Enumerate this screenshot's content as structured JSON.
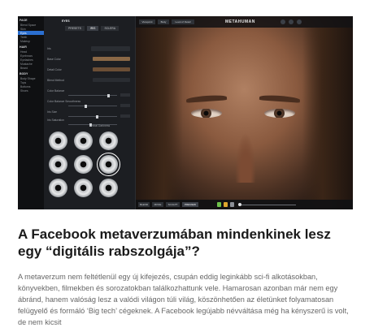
{
  "screenshot": {
    "brand": "METAHUMAN",
    "sidebar": [
      {
        "label": "FACE",
        "type": "section"
      },
      {
        "label": "Blend Space",
        "type": "item"
      },
      {
        "label": "Skin",
        "type": "item"
      },
      {
        "label": "Eyes",
        "type": "item",
        "selected": true
      },
      {
        "label": "Teeth",
        "type": "item"
      },
      {
        "label": "Makeup",
        "type": "item"
      },
      {
        "label": "HAIR",
        "type": "section"
      },
      {
        "label": "Head",
        "type": "item"
      },
      {
        "label": "Eyebrows",
        "type": "item"
      },
      {
        "label": "Eyelashes",
        "type": "item"
      },
      {
        "label": "Mustache",
        "type": "item"
      },
      {
        "label": "Beard",
        "type": "item"
      },
      {
        "label": "BODY",
        "type": "section"
      },
      {
        "label": "Body Shape",
        "type": "item"
      },
      {
        "label": "Tops",
        "type": "item"
      },
      {
        "label": "Bottoms",
        "type": "item"
      },
      {
        "label": "Shoes",
        "type": "item"
      }
    ],
    "panel_title": "EYES",
    "panel_tabs": [
      "PRESETS",
      "IRIS",
      "SCLERA"
    ],
    "panel_rows": [
      {
        "label": "Iris"
      },
      {
        "label": "Base Color"
      },
      {
        "label": "Detail Color"
      },
      {
        "label": "Blend Method"
      },
      {
        "label": "Color Balance"
      },
      {
        "label": "Color Balance Smoothness"
      },
      {
        "label": "Iris Size"
      },
      {
        "label": "Iris Saturation"
      },
      {
        "label": "Limbal Darkness"
      }
    ],
    "toolbar_buttons": [
      "Viewpoint",
      "Body",
      "Level of Detail"
    ],
    "bottom_buttons": [
      "BLEND",
      "MOVE",
      "SCULPT",
      "PREVIEW"
    ],
    "colors": {
      "accent": "#2b6fd0",
      "base_swatch": "#8a6846",
      "detail_swatch": "#6b4e35"
    },
    "icons": [
      "metahuman-logo-icon",
      "play-icon",
      "record-icon"
    ]
  },
  "article": {
    "title": "A Facebook metaverzumában mindenkinek lesz egy “digitális rabszolgája”?",
    "body": "A metaverzum nem feltétlenül egy új kifejezés, csupán eddig leginkább sci-fi alkotásokban, könyvekben, filmekben és sorozatokban találkozhattunk vele. Hamarosan azonban már nem egy ábránd, hanem valóság lesz a valódi világon túli világ, köszönhetően az életünket folyamatosan felügyelő és formáló ‘Big tech’ cégeknek. A Facebook legújabb névváltása még ha kényszerű is volt, de nem kicsit"
  }
}
